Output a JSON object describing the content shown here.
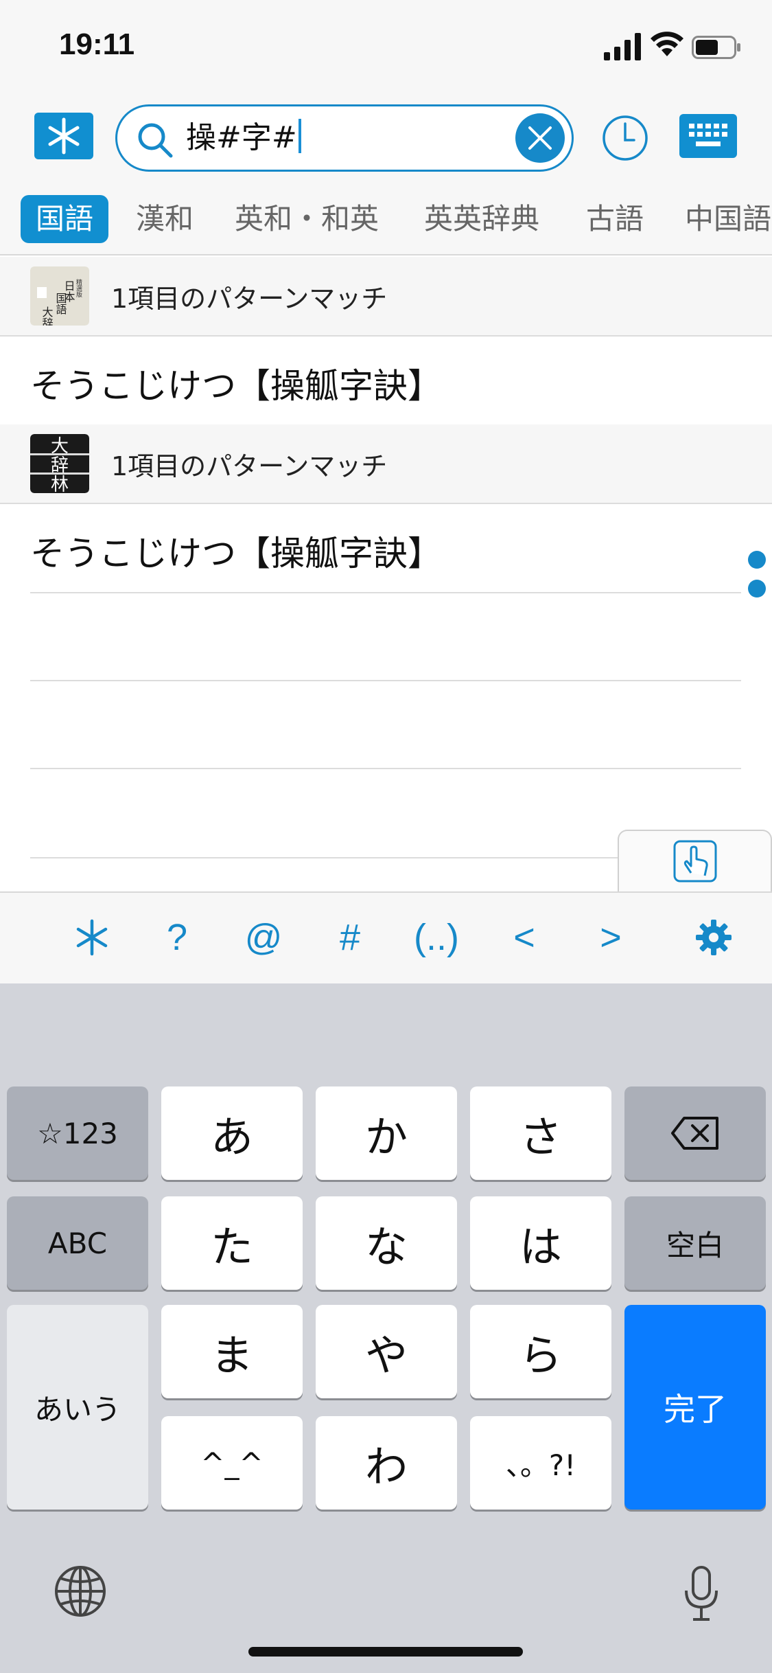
{
  "status_bar": {
    "time": "19:11"
  },
  "search": {
    "query": "操#字#"
  },
  "tabs": [
    {
      "label": "国語"
    },
    {
      "label": "漢和"
    },
    {
      "label": "英和・和英"
    },
    {
      "label": "英英辞典"
    },
    {
      "label": "古語"
    },
    {
      "label": "中国語"
    }
  ],
  "results": [
    {
      "dictionary_icon_text": "精選版 日本国語大辞典",
      "match_text": "1項目のパターンマッチ",
      "entry": "そうこじけつ【操觚字訣】"
    },
    {
      "dictionary_icon_text": "大辞林",
      "match_text": "1項目のパターンマッチ",
      "entry": "そうこじけつ【操觚字訣】"
    }
  ],
  "wildcard_bar": {
    "keys": [
      "?",
      "@",
      "#",
      "(..)",
      "<",
      ">"
    ]
  },
  "keyboard": {
    "row1": [
      "☆123",
      "あ",
      "か",
      "さ"
    ],
    "row2": [
      "ABC",
      "た",
      "な",
      "は",
      "空白"
    ],
    "row3": [
      "あいう",
      "ま",
      "や",
      "ら",
      "完了"
    ],
    "row4": [
      "^_^",
      "わ",
      "、。?!"
    ]
  },
  "colors": {
    "accent": "#118fd0",
    "return_key": "#0a7cff"
  }
}
